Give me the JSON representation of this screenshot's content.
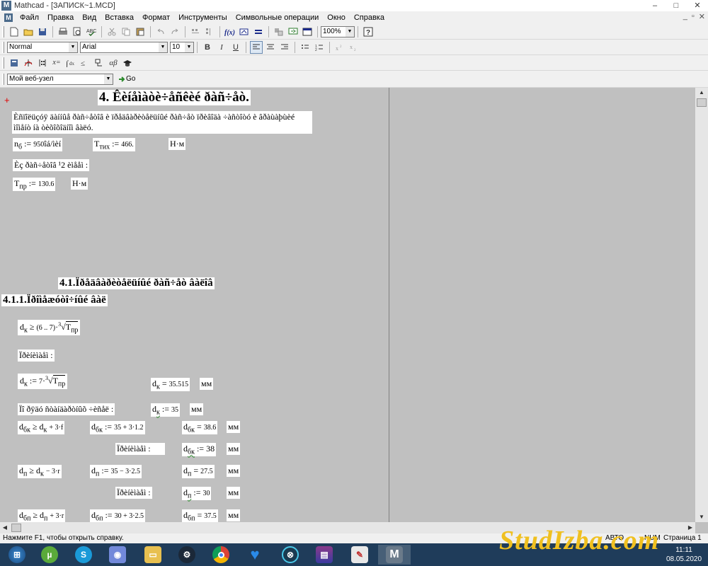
{
  "window": {
    "title": "Mathcad - [ЗАПИСК~1.MCD]",
    "app_icon_letter": "M",
    "controls": [
      "–",
      "□",
      "✕"
    ]
  },
  "menubar": {
    "items": [
      "Файл",
      "Правка",
      "Вид",
      "Вставка",
      "Формат",
      "Инструменты",
      "Символьные операции",
      "Окно",
      "Справка"
    ],
    "mdi_controls": [
      "_",
      "▫",
      "✕"
    ]
  },
  "toolbar": {
    "zoom": "100%"
  },
  "format_bar": {
    "style": "Normal",
    "font": "Arial",
    "size": "10",
    "bold": "B",
    "italic": "I",
    "underline": "U"
  },
  "math_bar": {
    "x_eq": "x=",
    "alpha_beta": "αβ"
  },
  "web_bar": {
    "site": "Мой веб-узел",
    "go": "Go"
  },
  "worksheet": {
    "section_title": "4. Êèíåìàòè÷åñêèé ðàñ÷åò.",
    "intro_text": "Èñïîëüçóÿ äàííûå ðàñ÷åòîâ è ïðåäâàðèòåëüíûé ðàñ÷åò ïðèâîäà ÷àñòîòó è âðàùàþùèé ìîìåíò íà òèõîõîäíîì âàëó.",
    "n_b": {
      "lhs": "n",
      "sub": "б",
      "op": ":=",
      "value": "950",
      "unit": "îá/ìèí"
    },
    "t_tih": {
      "lhs": "T",
      "sub": "тих",
      "op": ":=",
      "value": "466.",
      "unit": "Н·м"
    },
    "from_calc": "Èç ðàñ÷åòîâ ¹2 èìååì :",
    "t_pr": {
      "lhs": "T",
      "sub": "пр",
      "op": ":=",
      "value": "130.6",
      "unit": "Н·м"
    },
    "subsection": "4.1.Ïðåäâàðèòåëüíûé ðàñ÷åò âàëîâ",
    "subsubsection": "4.1.1.Ïðîìåæóòî÷íûé âàë",
    "dk_ineq": {
      "lhs": "d",
      "sub": "к",
      "rel": "≥",
      "range": "(6 .. 7)",
      "root_index": "3",
      "under": "T",
      "under_sub": "пр"
    },
    "accept1": "Ïðèíèìàåì :",
    "dk_def": {
      "lhs": "d",
      "sub": "к",
      "op": ":=",
      "coef": "7",
      "root_index": "3",
      "under": "T",
      "under_sub": "пр"
    },
    "dk_result": {
      "lhs": "d",
      "sub": "к",
      "op": "=",
      "value": "35.515",
      "unit": "мм"
    },
    "standard_row": "Ïî ðÿäó ñòàíäàðòíûõ ÷èñåë :",
    "dk_std": {
      "lhs": "d",
      "sub": "к",
      "op": ":=",
      "value": "35",
      "unit": "мм"
    },
    "dbk_ineq": {
      "lhs": "d",
      "sub": "бк",
      "rel": "≥",
      "rhs": "d",
      "rhs_sub": "к",
      "tail": "+ 3·f"
    },
    "dbk_def": {
      "lhs": "d",
      "sub": "бк",
      "op": ":=",
      "expr": "35 + 3·1.2"
    },
    "dbk_result": {
      "lhs": "d",
      "sub": "бк",
      "op": "=",
      "value": "38.6",
      "unit": "мм"
    },
    "accept2": "Ïðèíèìàåì :",
    "dbk_std": {
      "lhs": "d",
      "sub": "бк",
      "op": ":=",
      "value": "38",
      "unit": "мм"
    },
    "dp_ineq": {
      "lhs": "d",
      "sub": "п",
      "rel": "≥",
      "rhs": "d",
      "rhs_sub": "к",
      "tail": "− 3·r"
    },
    "dp_def": {
      "lhs": "d",
      "sub": "п",
      "op": ":=",
      "expr": "35 − 3·2.5"
    },
    "dp_result": {
      "lhs": "d",
      "sub": "п",
      "op": "=",
      "value": "27.5",
      "unit": "мм"
    },
    "accept3": "Ïðèíèìàåì :",
    "dp_std": {
      "lhs": "d",
      "sub": "п",
      "op": ":=",
      "value": "30",
      "unit": "мм"
    },
    "dbp_ineq": {
      "lhs": "d",
      "sub": "бп",
      "rel": "≥",
      "rhs": "d",
      "rhs_sub": "п",
      "tail": "+ 3·r"
    },
    "dbp_def": {
      "lhs": "d",
      "sub": "бп",
      "op": ":=",
      "expr": "30 + 3·2.5"
    },
    "dbp_result": {
      "lhs": "d",
      "sub": "бп",
      "op": "=",
      "value": "37.5",
      "unit": "мм"
    }
  },
  "statusbar": {
    "help": "Нажмите F1, чтобы открыть справку.",
    "mode": "АВТО",
    "num": "NUM",
    "page": "Страница 1"
  },
  "taskbar": {
    "time": "11:11",
    "date": "08.05.2020"
  },
  "watermark": {
    "text": "StudIzba.com"
  },
  "colors": {
    "accent_red": "#e00000",
    "watermark": "#f0c020",
    "taskbar": "#1f3c5a"
  }
}
